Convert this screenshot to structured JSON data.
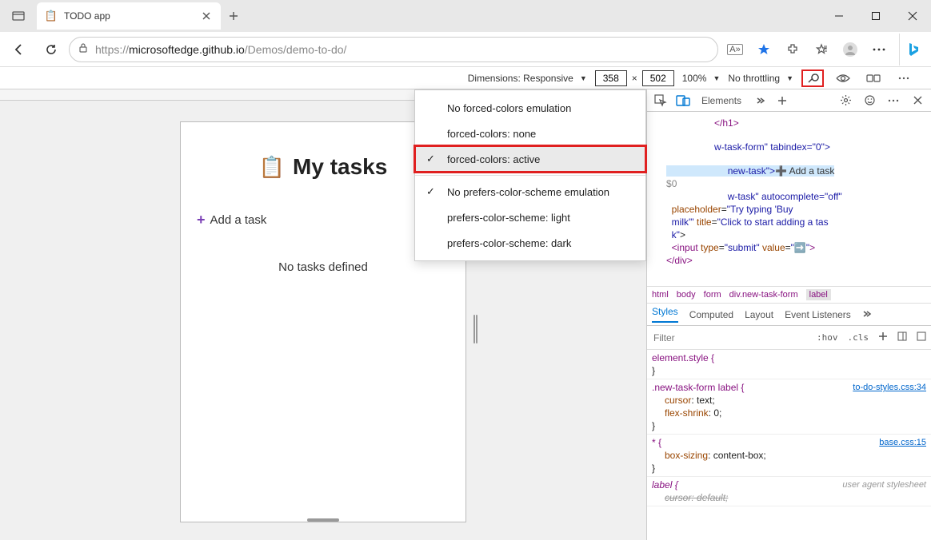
{
  "titlebar": {
    "tab_title": "TODO app"
  },
  "addressbar": {
    "url_host": "microsoftedge.github.io",
    "url_prefix": "https://",
    "url_path": "/Demos/demo-to-do/"
  },
  "device_toolbar": {
    "dimensions_label": "Dimensions: Responsive",
    "width": "358",
    "height": "502",
    "zoom": "100%",
    "throttling": "No throttling"
  },
  "dropdown": {
    "items": [
      {
        "label": "No forced-colors emulation",
        "checked": false
      },
      {
        "label": "forced-colors: none",
        "checked": false
      },
      {
        "label": "forced-colors: active",
        "checked": true,
        "highlighted": true
      },
      {
        "label": "No prefers-color-scheme emulation",
        "checked": true
      },
      {
        "label": "prefers-color-scheme: light",
        "checked": false
      },
      {
        "label": "prefers-color-scheme: dark",
        "checked": false
      }
    ]
  },
  "app": {
    "title": "My tasks",
    "add_task_label": "Add a task",
    "no_tasks_label": "No tasks defined"
  },
  "devtools": {
    "tabs": {
      "elements": "Elements"
    },
    "dom": {
      "h1_close": "</h1>",
      "form_open": "w-task-form\" tabindex=\"0\">",
      "label_attr": "new-task\">",
      "add_task_text": "➕ Add a task",
      "before_marker": "$0",
      "input_line1": "w-task\" autocomplete=\"off\"",
      "input_line2": "placeholder=\"Try typing 'Buy",
      "input_line3": "milk'\" title=\"Click to start adding a tas",
      "input_line4": "k\">",
      "submit_line": "<input type=\"submit\" value=\"➡️\">",
      "div_close": "</div>"
    },
    "breadcrumb": [
      "html",
      "body",
      "form",
      "div.new-task-form",
      "label"
    ],
    "styles_tabs": [
      "Styles",
      "Computed",
      "Layout",
      "Event Listeners"
    ],
    "filter_placeholder": "Filter",
    "hov": ":hov",
    "cls": ".cls",
    "rules": [
      {
        "selector": "element.style {",
        "props": [],
        "close": "}"
      },
      {
        "selector": ".new-task-form label {",
        "source": "to-do-styles.css:34",
        "props": [
          {
            "n": "cursor",
            "v": "text;"
          },
          {
            "n": "flex-shrink",
            "v": "0;"
          }
        ],
        "close": "}"
      },
      {
        "selector": "* {",
        "source": "base.css:15",
        "props": [
          {
            "n": "box-sizing",
            "v": "content-box;"
          }
        ],
        "close": "}"
      },
      {
        "selector": "label {",
        "ua": "user agent stylesheet",
        "props": [
          {
            "n": "cursor",
            "v": "default;",
            "strike": true
          }
        ]
      }
    ]
  }
}
